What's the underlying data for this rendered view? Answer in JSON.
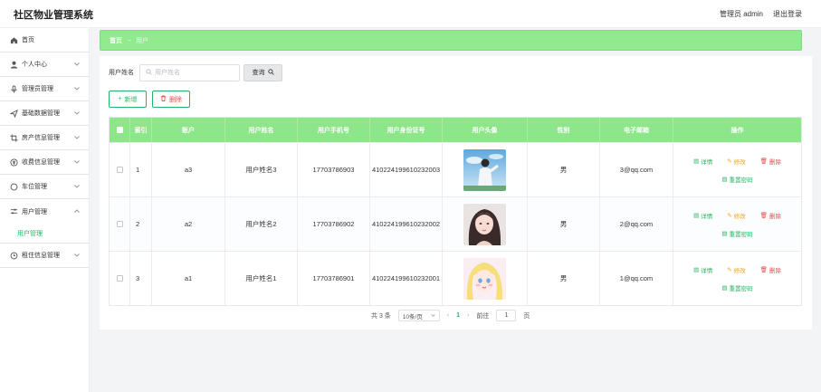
{
  "app": {
    "title": "社区物业管理系统"
  },
  "header": {
    "admin": "管理员 admin",
    "logout": "退出登录"
  },
  "sidebar": {
    "items": [
      {
        "label": "首页",
        "icon": "home-icon"
      },
      {
        "label": "个人中心",
        "icon": "user-icon"
      },
      {
        "label": "管理员管理",
        "icon": "microphone-icon"
      },
      {
        "label": "基础数据管理",
        "icon": "send-icon"
      },
      {
        "label": "房产信息管理",
        "icon": "crop-icon"
      },
      {
        "label": "收费信息管理",
        "icon": "money-icon"
      },
      {
        "label": "车位管理",
        "icon": "circle-icon"
      },
      {
        "label": "用户管理",
        "icon": "sliders-icon"
      },
      {
        "label": "租住信息管理",
        "icon": "clock-icon"
      }
    ],
    "sub_active": "用户管理"
  },
  "breadcrumb": {
    "root": "首页",
    "arrow": "→",
    "current": "用户"
  },
  "search": {
    "label": "用户姓名",
    "placeholder": "用户姓名",
    "button": "查询"
  },
  "actions": {
    "add": "新增",
    "delete": "删除"
  },
  "table": {
    "headers": [
      "索引",
      "账户",
      "用户姓名",
      "用户手机号",
      "用户身份证号",
      "用户头像",
      "性别",
      "电子邮箱",
      "操作"
    ],
    "rows": [
      {
        "index": "1",
        "account": "a3",
        "name": "用户姓名3",
        "phone": "17703786903",
        "idcard": "410224199610232003",
        "gender": "男",
        "email": "3@qq.com"
      },
      {
        "index": "2",
        "account": "a2",
        "name": "用户姓名2",
        "phone": "17703786902",
        "idcard": "410224199610232002",
        "gender": "男",
        "email": "2@qq.com"
      },
      {
        "index": "3",
        "account": "a1",
        "name": "用户姓名1",
        "phone": "17703786901",
        "idcard": "410224199610232001",
        "gender": "男",
        "email": "1@qq.com"
      }
    ],
    "ops": {
      "detail": "详情",
      "edit": "修改",
      "remove": "删除",
      "reset": "重置密码"
    }
  },
  "pagination": {
    "total": "共 3 条",
    "page_size": "10条/页",
    "current": "1",
    "goto_label": "前往",
    "goto_value": "1",
    "page_unit": "页"
  },
  "colors": {
    "primary": "#29b463",
    "header_green": "#8ee68a",
    "danger": "#e64b4b",
    "warning": "#f0a020"
  }
}
